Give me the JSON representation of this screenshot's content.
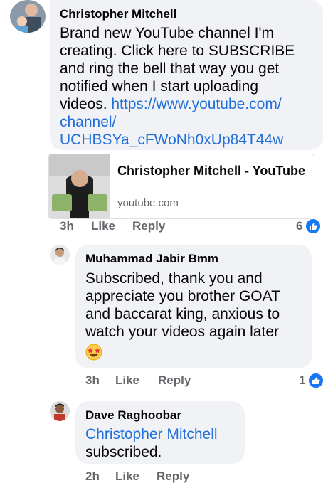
{
  "comments": [
    {
      "author": "Christopher Mitchell",
      "text": "Brand new YouTube channel I'm creating. Click here to SUBSCRIBE and ring the bell that way you get notified when I start uploading videos.",
      "link": "https://www.youtube.com/channel/UCHBSYa_cFWoNh0xUp84T44w",
      "link_lines": [
        "https://www.youtube.com/",
        "channel/",
        "UCHBSYa_cFWoNh0xUp84T44w"
      ],
      "text_lines": [
        "Brand new YouTube channel I'm",
        "creating. Click here to SUBSCRIBE",
        "and ring the bell that way you get",
        "notified when I start uploading",
        "videos. "
      ],
      "preview": {
        "title": "Christopher Mitchell - YouTube",
        "domain": "youtube.com"
      },
      "time": "3h",
      "like_label": "Like",
      "reply_label": "Reply",
      "reaction_count": "6"
    },
    {
      "author": "Muhammad Jabir Bmm",
      "text_lines": [
        "Subscribed, thank you and",
        "appreciate you brother GOAT",
        "and baccarat king, anxious to",
        "watch your videos again later"
      ],
      "emoji": "star-struck-emoji",
      "time": "3h",
      "like_label": "Like",
      "reply_label": "Reply",
      "reaction_count": "1"
    },
    {
      "author": "Dave Raghoobar",
      "mention": "Christopher Mitchell",
      "text": "subscribed.",
      "time": "2h",
      "like_label": "Like",
      "reply_label": "Reply"
    }
  ],
  "colors": {
    "bubble": "#f0f2f5",
    "link": "#216fdb",
    "like_blue": "#1877f2",
    "meta": "#65676b"
  }
}
